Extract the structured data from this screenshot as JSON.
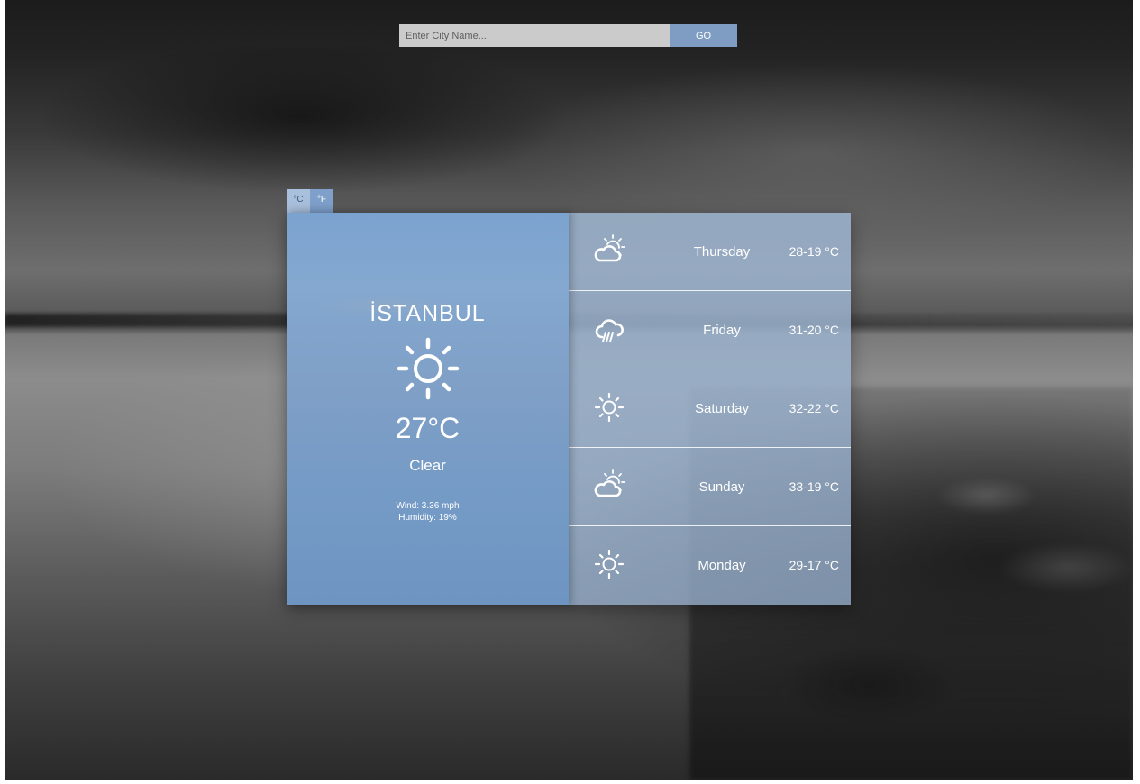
{
  "search": {
    "placeholder": "Enter City Name...",
    "button_label": "GO"
  },
  "units": {
    "celsius_label": "°C",
    "fahrenheit_label": "°F",
    "selected": "°C"
  },
  "current": {
    "city": "İSTANBUL",
    "icon": "sun-icon",
    "temperature": "27°C",
    "condition": "Clear",
    "wind": "Wind: 3.36 mph",
    "humidity": "Humidity: 19%"
  },
  "forecast": [
    {
      "day": "Thursday",
      "range": "28-19 °C",
      "icon": "partly-cloudy-icon"
    },
    {
      "day": "Friday",
      "range": "31-20 °C",
      "icon": "rain-cloud-icon"
    },
    {
      "day": "Saturday",
      "range": "32-22 °C",
      "icon": "sun-icon"
    },
    {
      "day": "Sunday",
      "range": "33-19 °C",
      "icon": "partly-cloudy-icon"
    },
    {
      "day": "Monday",
      "range": "29-17 °C",
      "icon": "sun-icon"
    }
  ],
  "colors": {
    "current_panel": "#7ba3cf",
    "forecast_panel": "#a0b8d4",
    "go_button": "#7f9cc2",
    "search_field": "#cbcbcb"
  }
}
